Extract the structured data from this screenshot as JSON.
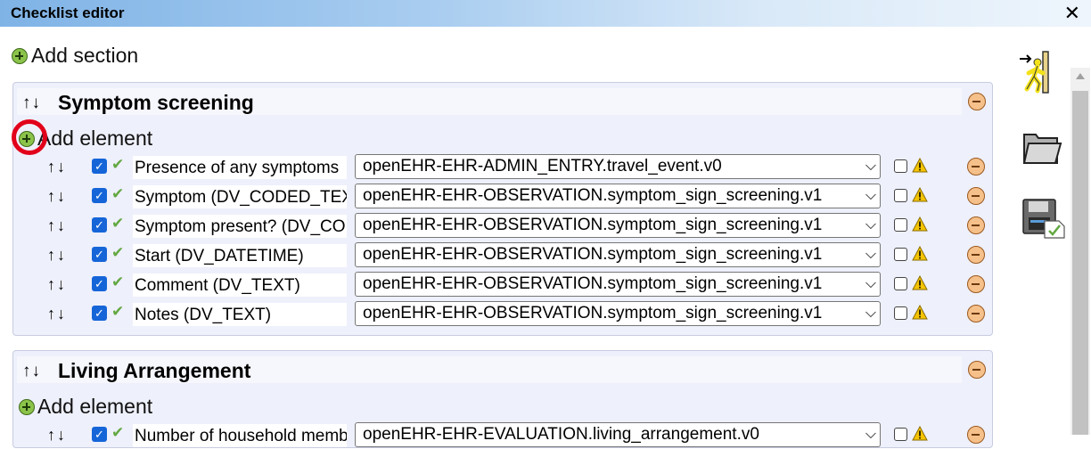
{
  "window": {
    "title": "Checklist editor",
    "close_glyph": "✕"
  },
  "toolbar": {
    "add_section_label": "Add section"
  },
  "sections": [
    {
      "title": "Symptom screening",
      "arrows": "↑↓",
      "add_element_label": "Add element",
      "rows": [
        {
          "name": "Presence of any symptoms",
          "archetype": "openEHR-EHR-ADMIN_ENTRY.travel_event.v0"
        },
        {
          "name": "Symptom (DV_CODED_TEXT)",
          "archetype": "openEHR-EHR-OBSERVATION.symptom_sign_screening.v1"
        },
        {
          "name": "Symptom present? (DV_CODED_TEXT)",
          "archetype": "openEHR-EHR-OBSERVATION.symptom_sign_screening.v1"
        },
        {
          "name": "Start (DV_DATETIME)",
          "archetype": "openEHR-EHR-OBSERVATION.symptom_sign_screening.v1"
        },
        {
          "name": "Comment (DV_TEXT)",
          "archetype": "openEHR-EHR-OBSERVATION.symptom_sign_screening.v1"
        },
        {
          "name": "Notes (DV_TEXT)",
          "archetype": "openEHR-EHR-OBSERVATION.symptom_sign_screening.v1"
        }
      ]
    },
    {
      "title": "Living Arrangement",
      "arrows": "↑↓",
      "add_element_label": "Add element",
      "rows": [
        {
          "name": "Number of household members",
          "archetype": "openEHR-EHR-EVALUATION.living_arrangement.v0"
        }
      ]
    }
  ],
  "icons": {
    "add": "plus-circle-icon",
    "remove": "minus-circle-icon",
    "exit": "exit-door-icon",
    "open": "folder-icon",
    "save": "save-icon",
    "warning": "warning-icon"
  },
  "colors": {
    "accent": "#1565d8",
    "add_green": "#8bc34a",
    "remove_orange": "#f6c08a",
    "highlight_red": "#e2001a"
  }
}
